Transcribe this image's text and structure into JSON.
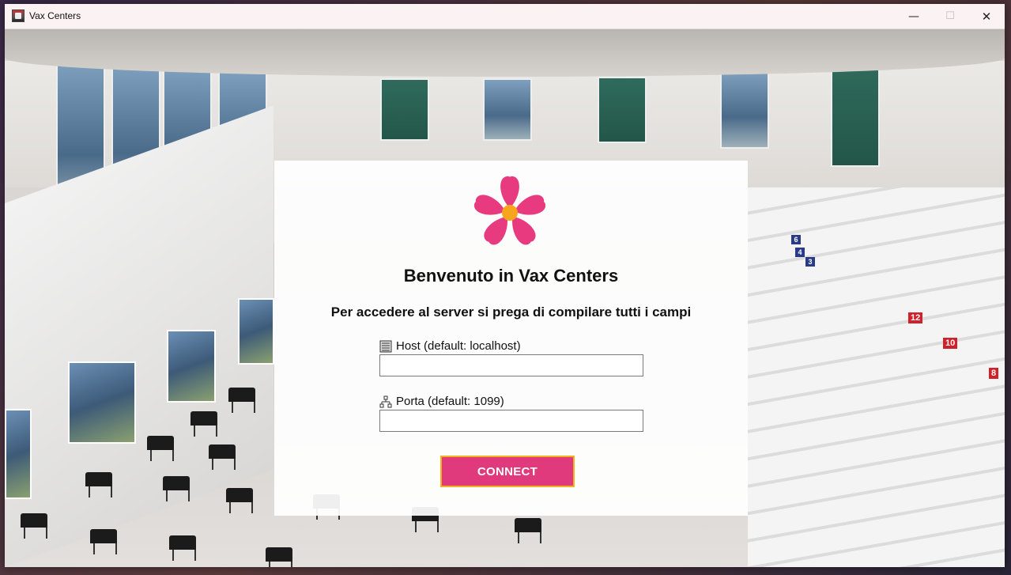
{
  "window": {
    "title": "Vax Centers",
    "controls": {
      "minimize": "—",
      "maximize": "☐",
      "close": "✕"
    }
  },
  "login": {
    "heading": "Benvenuto in Vax Centers",
    "subheading": "Per accedere al server si prega di compilare tutti i campi",
    "host_label": "Host (default: localhost)",
    "host_value": "",
    "port_label": "Porta (default: 1099)",
    "port_value": "",
    "connect_label": "CONNECT",
    "logo_icon": "pink-flower-icon",
    "host_icon": "server-icon",
    "port_icon": "network-icon"
  },
  "colors": {
    "accent": "#e03a7c",
    "button_border": "#f0b21f",
    "flower_center": "#f7a51c"
  }
}
